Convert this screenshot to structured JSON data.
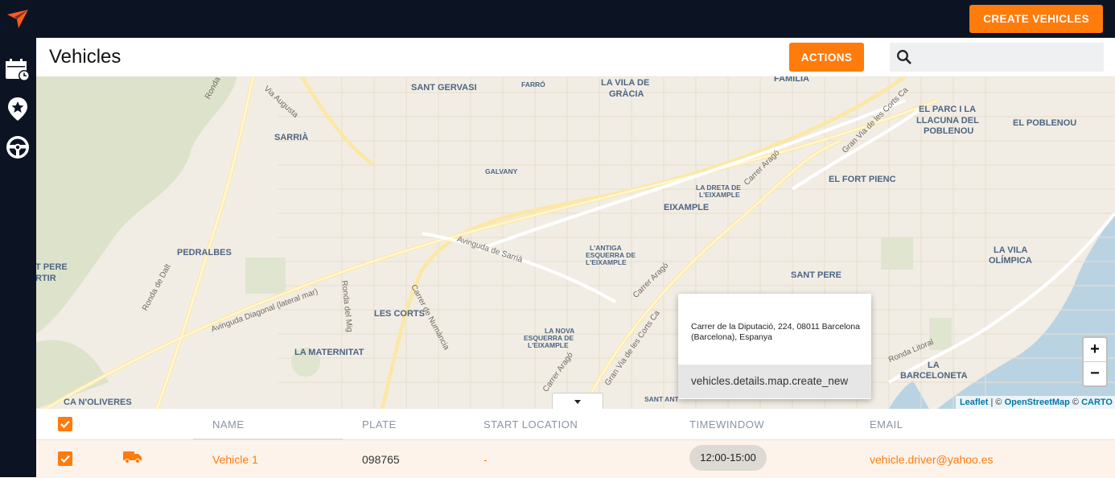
{
  "topbar": {
    "logo_icon": "paper-plane-logo-icon",
    "create_button_label": "CREATE VEHICLES"
  },
  "sidebar": {
    "items": [
      {
        "icon": "calendar-clock-icon"
      },
      {
        "icon": "star-pin-icon"
      },
      {
        "icon": "steering-wheel-icon"
      }
    ]
  },
  "header": {
    "title": "Vehicles",
    "actions_label": "ACTIONS",
    "search_placeholder": "",
    "search_icon": "search-icon"
  },
  "map": {
    "districts": {
      "sant_gervasi": "SANT GERVASI",
      "farro": "FARRÓ",
      "vila_gracia_1": "LA VILA DE",
      "vila_gracia_2": "GRÀCIA",
      "familia": "FAMILIA",
      "sarria": "SARRIÀ",
      "galvany": "GALVANY",
      "dreta_1": "LA DRETA DE",
      "dreta_2": "L'EIXAMPLE",
      "eixample": "EIXAMPLE",
      "fort_pienc": "EL FORT PIENC",
      "parc_1": "EL PARC I LA",
      "parc_2": "LLACUNA DEL",
      "parc_3": "POBLENOU",
      "poblenou": "EL POBLENOU",
      "pedralbes": "PEDRALBES",
      "antiga_1": "L'ANTIGA",
      "antiga_2": "ESQUERRA DE",
      "antiga_3": "L'EIXAMPLE",
      "sant_pere": "SANT PERE",
      "vila_olimpica_1": "LA VILA",
      "vila_olimpica_2": "OLÍMPICA",
      "pere_1": "T PERE",
      "pere_2": "RTIR",
      "les_corts": "LES CORTS",
      "nova_1": "LA NOVA",
      "nova_2": "ESQUERRA DE",
      "nova_3": "L'EIXAMPLE",
      "maternitat": "LA MATERNITAT",
      "barceloneta_1": "LA",
      "barceloneta_2": "BARCELONETA",
      "oliveres": "CA N'OLIVERES",
      "sant_ant": "SANT ANT"
    },
    "streets": {
      "ronda_dalt_top": "Ronda de Dalt",
      "via_augusta": "Via Augusta",
      "gran_via_top": "Gran Via de les Corts Ca",
      "carrer_arago_top": "Carrer Aragó",
      "avinguda_sarria": "Avinguda de Sarrià",
      "carrer_arago_mid": "Carrer Aragó",
      "ronda_dalt_left": "Ronda de Dalt",
      "diagonal": "Avinguda Diagonal (lateral mar)",
      "ronda_mig": "Ronda del Mig",
      "numancia": "Carrer de Numància",
      "gran_via_bottom": "Gran Via de les Corts Ca",
      "carrer_arago_bottom": "Carrer Aragó",
      "ronda_litoral": "Ronda Litoral"
    },
    "popup": {
      "address": "Carrer de la Diputació, 224, 08011 Barcelona (Barcelona), Espanya",
      "action_label": "vehicles.details.map.create_new"
    },
    "zoom_in": "+",
    "zoom_out": "−",
    "attribution": {
      "leaflet": "Leaflet",
      "sep1": " | © ",
      "osm": "OpenStreetMap",
      "sep2": " © ",
      "carto": "CARTO"
    }
  },
  "table": {
    "columns": [
      "NAME",
      "PLATE",
      "START LOCATION",
      "TIMEWINDOW",
      "EMAIL"
    ],
    "rows": [
      {
        "checked": true,
        "icon": "truck-icon",
        "name": "Vehicle 1",
        "plate": "098765",
        "start_location": "-",
        "timewindow": "12:00-15:00",
        "email": "vehicle.driver@yahoo.es"
      }
    ]
  },
  "colors": {
    "accent": "#ff7b0c",
    "nav_bg": "#0c1424",
    "map_bg": "#f2ede4",
    "water": "#b9d3e3",
    "park": "#dfe5cf"
  }
}
